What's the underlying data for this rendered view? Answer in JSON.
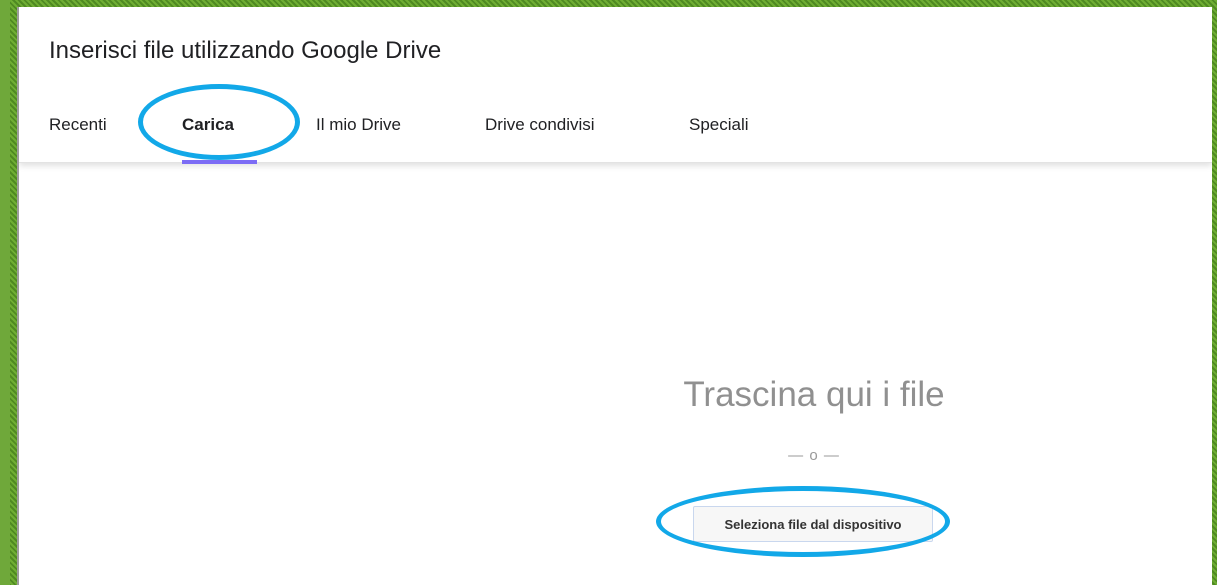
{
  "dialog": {
    "title": "Inserisci file utilizzando Google Drive"
  },
  "tabs": [
    {
      "label": "Recenti",
      "active": false
    },
    {
      "label": "Carica",
      "active": true
    },
    {
      "label": "Il mio Drive",
      "active": false
    },
    {
      "label": "Drive condivisi",
      "active": false
    },
    {
      "label": "Speciali",
      "active": false
    }
  ],
  "upload": {
    "drop_text": "Trascina qui i file",
    "or_text": "— o —",
    "select_button_label": "Seleziona file dal dispositivo"
  },
  "colors": {
    "background": "#5f9a2c",
    "highlight_ring": "#12a8e8",
    "tab_indicator": "#7c6cf5"
  },
  "annotations": {
    "highlighted_items": [
      "tab-carica",
      "select-files-button"
    ]
  }
}
